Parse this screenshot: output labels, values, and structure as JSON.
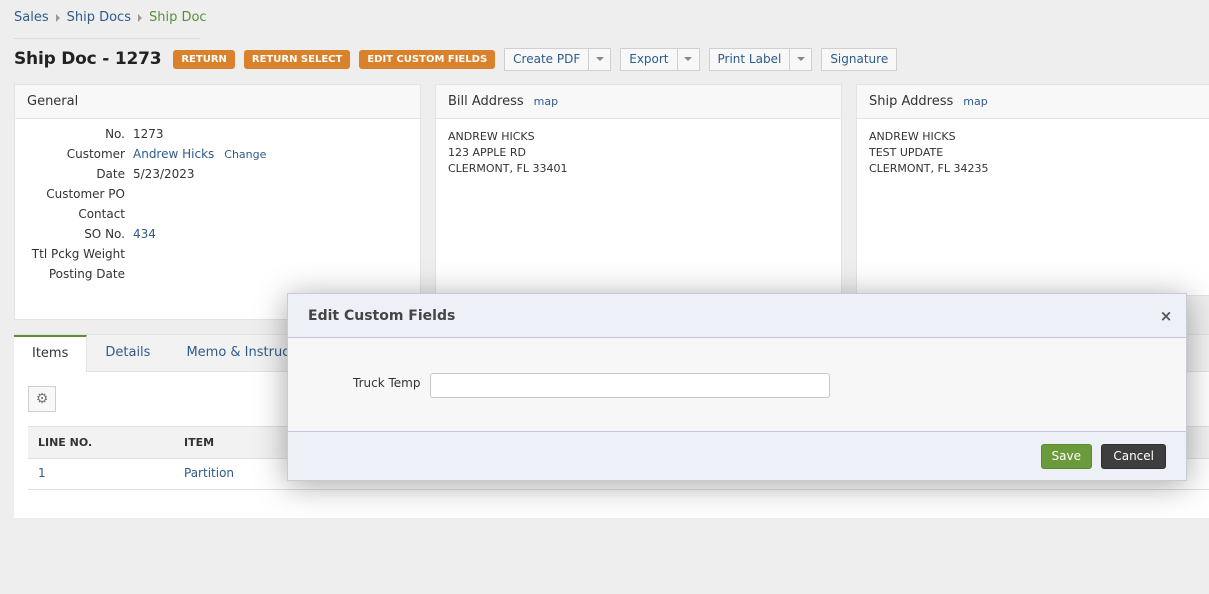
{
  "breadcrumb": [
    "Sales",
    "Ship Docs",
    "Ship Doc"
  ],
  "title": "Ship Doc - 1273",
  "actions": {
    "return": "RETURN",
    "return_select": "RETURN SELECT",
    "edit_custom_fields": "EDIT CUSTOM FIELDS",
    "create_pdf": "Create PDF",
    "export": "Export",
    "print_label": "Print Label",
    "signature": "Signature"
  },
  "general": {
    "heading": "General",
    "fields": [
      {
        "label": "No.",
        "value": "1273"
      },
      {
        "label": "Customer",
        "value": "Andrew Hicks",
        "action": "Change"
      },
      {
        "label": "Date",
        "value": "5/23/2023"
      },
      {
        "label": "Customer PO",
        "value": ""
      },
      {
        "label": "Contact",
        "value": ""
      },
      {
        "label": "SO No.",
        "value": "434"
      },
      {
        "label": "Ttl Pckg Weight",
        "value": ""
      },
      {
        "label": "Posting Date",
        "value": ""
      }
    ]
  },
  "bill_address": {
    "heading": "Bill Address",
    "map_label": "map",
    "lines": [
      "ANDREW HICKS",
      "123 APPLE RD",
      "CLERMONT, FL 33401"
    ]
  },
  "ship_address": {
    "heading": "Ship Address",
    "map_label": "map",
    "lines": [
      "ANDREW HICKS",
      "TEST UPDATE",
      "CLERMONT, FL 34235"
    ]
  },
  "tabs": [
    "Items",
    "Details",
    "Memo & Instruct"
  ],
  "grid": {
    "columns": [
      "LINE NO.",
      "ITEM"
    ],
    "rows": [
      {
        "line": "1",
        "item": "Partition"
      }
    ]
  },
  "modal": {
    "title": "Edit Custom Fields",
    "close": "×",
    "field_label": "Truck Temp",
    "field_value": "",
    "save": "Save",
    "cancel": "Cancel"
  }
}
